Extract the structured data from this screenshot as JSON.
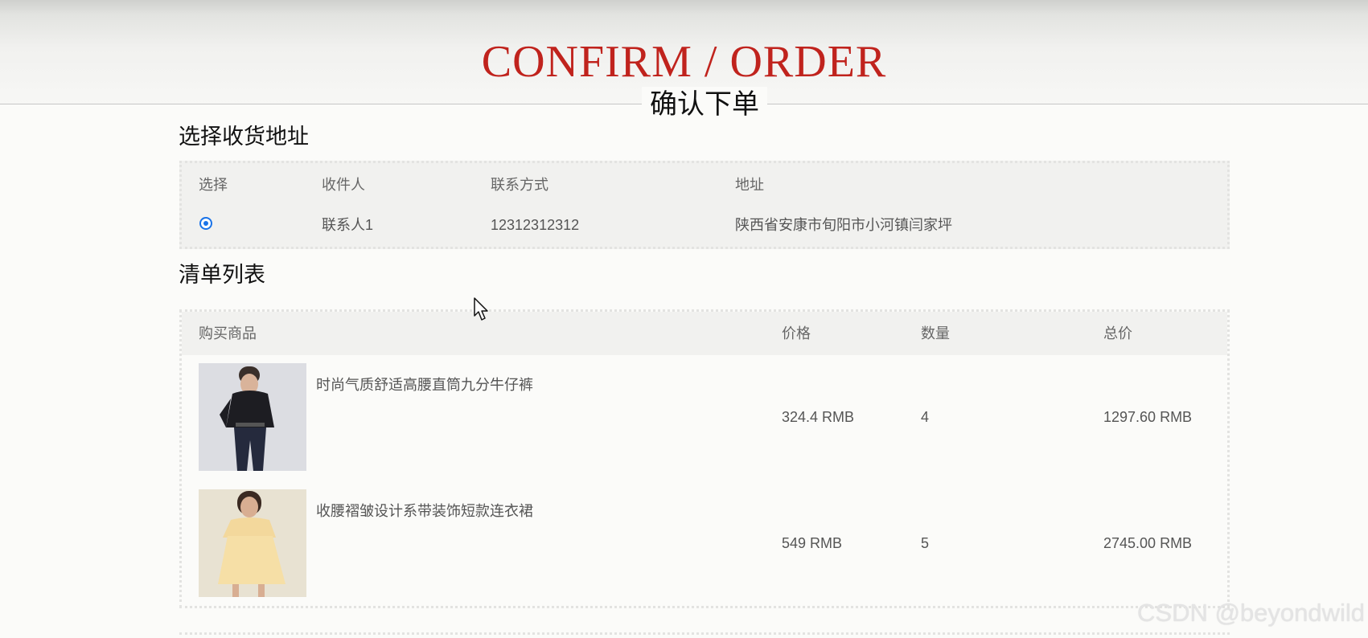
{
  "header": {
    "title_en": "CONFIRM / ORDER",
    "title_cn": "确认下单"
  },
  "address_section": {
    "title": "选择收货地址",
    "columns": [
      "选择",
      "收件人",
      "联系方式",
      "地址"
    ],
    "rows": [
      {
        "selected": true,
        "recipient": "联系人1",
        "phone": "12312312312",
        "address": "陕西省安康市旬阳市小河镇闫家坪"
      }
    ]
  },
  "list_section": {
    "title": "清单列表",
    "columns": [
      "购买商品",
      "价格",
      "数量",
      "总价"
    ],
    "items": [
      {
        "name": "时尚气质舒适高腰直筒九分牛仔裤",
        "price": "324.4 RMB",
        "quantity": "4",
        "total": "1297.60 RMB"
      },
      {
        "name": "收腰褶皱设计系带装饰短款连衣裙",
        "price": "549 RMB",
        "quantity": "5",
        "total": "2745.00 RMB"
      }
    ]
  },
  "watermark": "CSDN @beyondwild",
  "colors": {
    "title_red": "#c0231d",
    "radio_blue": "#1a73e8"
  }
}
